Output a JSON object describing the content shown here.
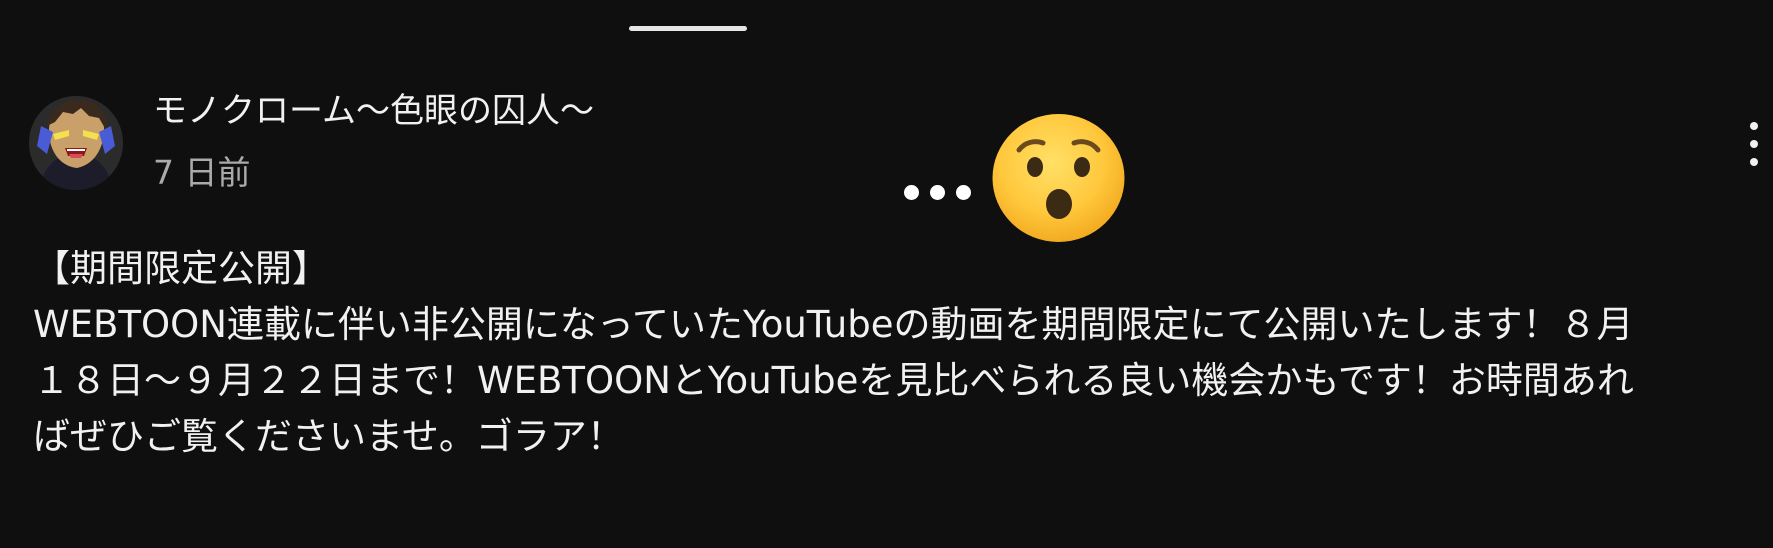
{
  "sheet": {
    "handle_icon": "drag-handle"
  },
  "post": {
    "channel_name": "モノクローム〜色眼の囚人〜",
    "age": "7 日前",
    "avatar_icon": "channel-avatar",
    "menu_icon": "more-vertical-icon",
    "overlay_emoji": "hushed-face-emoji",
    "overlay_text": "…",
    "body_lines": [
      "【期間限定公開】",
      "WEBTOON連載に伴い非公開になっていたYouTubeの動画を期間限定にて公開いたします！８月",
      "１８日〜９月２２日まで！WEBTOONとYouTubeを見比べられる良い機会かもです！お時間あれ",
      "ばぜひご覧くださいませ。ゴラア！"
    ]
  },
  "colors": {
    "background": "#0f0f0f",
    "primary_text": "#f1f1f1",
    "secondary_text": "#aaaaaa",
    "emoji_yellow": "#ffc83d"
  }
}
